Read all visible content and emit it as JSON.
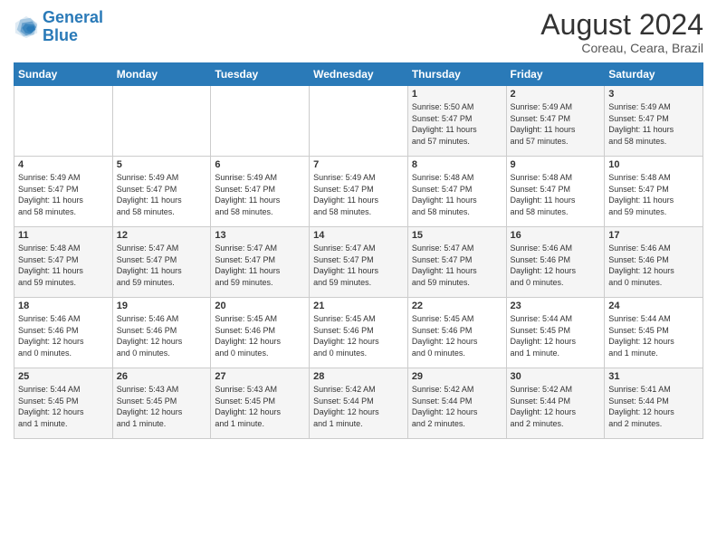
{
  "header": {
    "logo_line1": "General",
    "logo_line2": "Blue",
    "main_title": "August 2024",
    "subtitle": "Coreau, Ceara, Brazil"
  },
  "calendar": {
    "weekdays": [
      "Sunday",
      "Monday",
      "Tuesday",
      "Wednesday",
      "Thursday",
      "Friday",
      "Saturday"
    ],
    "weeks": [
      [
        {
          "day": "",
          "info": ""
        },
        {
          "day": "",
          "info": ""
        },
        {
          "day": "",
          "info": ""
        },
        {
          "day": "",
          "info": ""
        },
        {
          "day": "1",
          "info": "Sunrise: 5:50 AM\nSunset: 5:47 PM\nDaylight: 11 hours\nand 57 minutes."
        },
        {
          "day": "2",
          "info": "Sunrise: 5:49 AM\nSunset: 5:47 PM\nDaylight: 11 hours\nand 57 minutes."
        },
        {
          "day": "3",
          "info": "Sunrise: 5:49 AM\nSunset: 5:47 PM\nDaylight: 11 hours\nand 58 minutes."
        }
      ],
      [
        {
          "day": "4",
          "info": "Sunrise: 5:49 AM\nSunset: 5:47 PM\nDaylight: 11 hours\nand 58 minutes."
        },
        {
          "day": "5",
          "info": "Sunrise: 5:49 AM\nSunset: 5:47 PM\nDaylight: 11 hours\nand 58 minutes."
        },
        {
          "day": "6",
          "info": "Sunrise: 5:49 AM\nSunset: 5:47 PM\nDaylight: 11 hours\nand 58 minutes."
        },
        {
          "day": "7",
          "info": "Sunrise: 5:49 AM\nSunset: 5:47 PM\nDaylight: 11 hours\nand 58 minutes."
        },
        {
          "day": "8",
          "info": "Sunrise: 5:48 AM\nSunset: 5:47 PM\nDaylight: 11 hours\nand 58 minutes."
        },
        {
          "day": "9",
          "info": "Sunrise: 5:48 AM\nSunset: 5:47 PM\nDaylight: 11 hours\nand 58 minutes."
        },
        {
          "day": "10",
          "info": "Sunrise: 5:48 AM\nSunset: 5:47 PM\nDaylight: 11 hours\nand 59 minutes."
        }
      ],
      [
        {
          "day": "11",
          "info": "Sunrise: 5:48 AM\nSunset: 5:47 PM\nDaylight: 11 hours\nand 59 minutes."
        },
        {
          "day": "12",
          "info": "Sunrise: 5:47 AM\nSunset: 5:47 PM\nDaylight: 11 hours\nand 59 minutes."
        },
        {
          "day": "13",
          "info": "Sunrise: 5:47 AM\nSunset: 5:47 PM\nDaylight: 11 hours\nand 59 minutes."
        },
        {
          "day": "14",
          "info": "Sunrise: 5:47 AM\nSunset: 5:47 PM\nDaylight: 11 hours\nand 59 minutes."
        },
        {
          "day": "15",
          "info": "Sunrise: 5:47 AM\nSunset: 5:47 PM\nDaylight: 11 hours\nand 59 minutes."
        },
        {
          "day": "16",
          "info": "Sunrise: 5:46 AM\nSunset: 5:46 PM\nDaylight: 12 hours\nand 0 minutes."
        },
        {
          "day": "17",
          "info": "Sunrise: 5:46 AM\nSunset: 5:46 PM\nDaylight: 12 hours\nand 0 minutes."
        }
      ],
      [
        {
          "day": "18",
          "info": "Sunrise: 5:46 AM\nSunset: 5:46 PM\nDaylight: 12 hours\nand 0 minutes."
        },
        {
          "day": "19",
          "info": "Sunrise: 5:46 AM\nSunset: 5:46 PM\nDaylight: 12 hours\nand 0 minutes."
        },
        {
          "day": "20",
          "info": "Sunrise: 5:45 AM\nSunset: 5:46 PM\nDaylight: 12 hours\nand 0 minutes."
        },
        {
          "day": "21",
          "info": "Sunrise: 5:45 AM\nSunset: 5:46 PM\nDaylight: 12 hours\nand 0 minutes."
        },
        {
          "day": "22",
          "info": "Sunrise: 5:45 AM\nSunset: 5:46 PM\nDaylight: 12 hours\nand 0 minutes."
        },
        {
          "day": "23",
          "info": "Sunrise: 5:44 AM\nSunset: 5:45 PM\nDaylight: 12 hours\nand 1 minute."
        },
        {
          "day": "24",
          "info": "Sunrise: 5:44 AM\nSunset: 5:45 PM\nDaylight: 12 hours\nand 1 minute."
        }
      ],
      [
        {
          "day": "25",
          "info": "Sunrise: 5:44 AM\nSunset: 5:45 PM\nDaylight: 12 hours\nand 1 minute."
        },
        {
          "day": "26",
          "info": "Sunrise: 5:43 AM\nSunset: 5:45 PM\nDaylight: 12 hours\nand 1 minute."
        },
        {
          "day": "27",
          "info": "Sunrise: 5:43 AM\nSunset: 5:45 PM\nDaylight: 12 hours\nand 1 minute."
        },
        {
          "day": "28",
          "info": "Sunrise: 5:42 AM\nSunset: 5:44 PM\nDaylight: 12 hours\nand 1 minute."
        },
        {
          "day": "29",
          "info": "Sunrise: 5:42 AM\nSunset: 5:44 PM\nDaylight: 12 hours\nand 2 minutes."
        },
        {
          "day": "30",
          "info": "Sunrise: 5:42 AM\nSunset: 5:44 PM\nDaylight: 12 hours\nand 2 minutes."
        },
        {
          "day": "31",
          "info": "Sunrise: 5:41 AM\nSunset: 5:44 PM\nDaylight: 12 hours\nand 2 minutes."
        }
      ]
    ]
  }
}
